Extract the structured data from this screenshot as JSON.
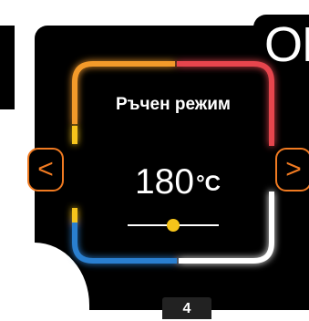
{
  "screen": {
    "title": "Ръчен режим",
    "temperature": "180",
    "temperature_unit": "°C",
    "ok_label": "OK",
    "prev_icon": "chevron-left-icon",
    "next_icon": "chevron-right-icon",
    "prev_glyph": "<",
    "next_glyph": ">",
    "page_number": "4",
    "slider_level": 0.5
  },
  "colors": {
    "background": "#000000",
    "accent_orange": "#f07a21",
    "frame_orange": "#f39a2b",
    "frame_red": "#e6454e",
    "frame_yellow": "#f6c41a",
    "frame_blue": "#2a7fd0",
    "frame_white": "#ffffff",
    "slider_knob": "#f6c41a"
  }
}
